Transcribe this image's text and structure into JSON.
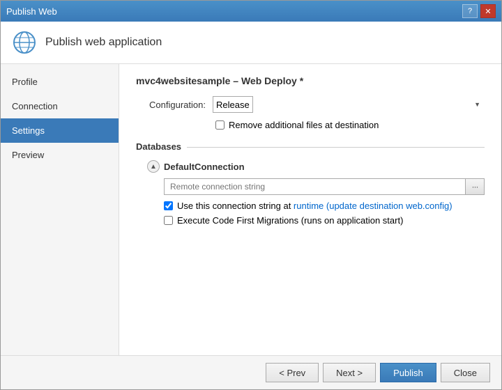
{
  "titleBar": {
    "title": "Publish Web",
    "helpBtn": "?",
    "closeBtn": "✕"
  },
  "header": {
    "title": "Publish web application"
  },
  "sidebar": {
    "items": [
      {
        "id": "profile",
        "label": "Profile"
      },
      {
        "id": "connection",
        "label": "Connection"
      },
      {
        "id": "settings",
        "label": "Settings"
      },
      {
        "id": "preview",
        "label": "Preview"
      }
    ],
    "activeItem": "settings"
  },
  "main": {
    "sectionTitle": "mvc4websitesample – Web Deploy *",
    "configurationLabel": "Configuration:",
    "configurationValue": "Release",
    "removeFilesLabel": "Remove additional files at destination",
    "databasesLabel": "Databases",
    "defaultConnection": {
      "name": "DefaultConnection",
      "placeholder": "Remote connection string",
      "useConnectionStringLabel": "Use this connection string at runtime (update destination web.config)",
      "executeMigrationsLabel": "Execute Code First Migrations (runs on application start)"
    }
  },
  "footer": {
    "prevLabel": "< Prev",
    "nextLabel": "Next >",
    "publishLabel": "Publish",
    "closeLabel": "Close"
  }
}
